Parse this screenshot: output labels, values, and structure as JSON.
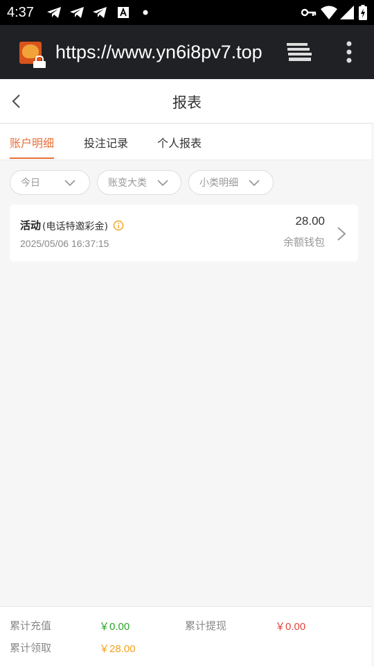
{
  "status_bar": {
    "time": "4:37",
    "notification_icons": [
      "telegram-icon",
      "telegram-icon",
      "telegram-icon",
      "accessibility-a-icon",
      "dot-icon"
    ],
    "system_icons": [
      "vpn-key-icon",
      "wifi-icon",
      "signal-icon",
      "battery-charging-icon"
    ]
  },
  "browser": {
    "url": "https://www.yn6i8pv7.top",
    "site_icon": "site-favicon",
    "tabs_icon": "tab-switcher-icon",
    "menu_icon": "more-vert-icon"
  },
  "header": {
    "title": "报表",
    "back_icon": "chevron-left-icon"
  },
  "tabs": {
    "items": [
      {
        "label": "账户明细",
        "active": true
      },
      {
        "label": "投注记录",
        "active": false
      },
      {
        "label": "个人报表",
        "active": false
      }
    ],
    "accent_color": "#e8703a"
  },
  "filters": [
    {
      "label": "今日"
    },
    {
      "label": "账变大类"
    },
    {
      "label": "小类明细"
    }
  ],
  "records": [
    {
      "title": "活动",
      "subtitle": "(电话特邀彩金)",
      "date": "2025/05/06 16:37:15",
      "amount": "28.00",
      "wallet": "余额钱包"
    }
  ],
  "footer": {
    "deposit_label": "累计充值",
    "deposit_value": "￥0.00",
    "deposit_color": "#2aa52a",
    "withdraw_label": "累计提现",
    "withdraw_value": "￥0.00",
    "withdraw_color": "#e2453c",
    "claim_label": "累计领取",
    "claim_value": "￥28.00",
    "claim_color": "#f0a21e"
  }
}
